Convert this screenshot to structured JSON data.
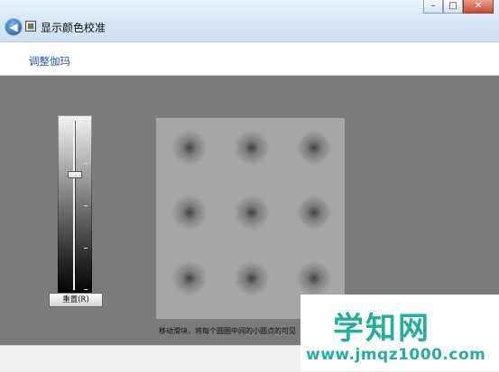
{
  "window": {
    "title": "显示颜色校准",
    "back_icon": "back-arrow-icon",
    "app_icon": "display-color-calibration-icon",
    "controls": {
      "minimize": "–",
      "maximize": "□",
      "close": "✕"
    }
  },
  "header": {
    "heading": "调整伽玛"
  },
  "slider": {
    "name": "gamma-slider",
    "value_fraction": 0.32,
    "reset_label": "重置(R)"
  },
  "preview": {
    "description": "gamma-test-pattern",
    "rows": 3,
    "cols": 3
  },
  "instruction": "移动滑块，将每个圆圈中间的小圆点的可见",
  "watermark": {
    "brand": "学知网",
    "url": "www.jmqz1000.com"
  },
  "colors": {
    "accent": "#1f5aa8",
    "content_bg": "#7b7b7b",
    "watermark": "#22b09a"
  }
}
